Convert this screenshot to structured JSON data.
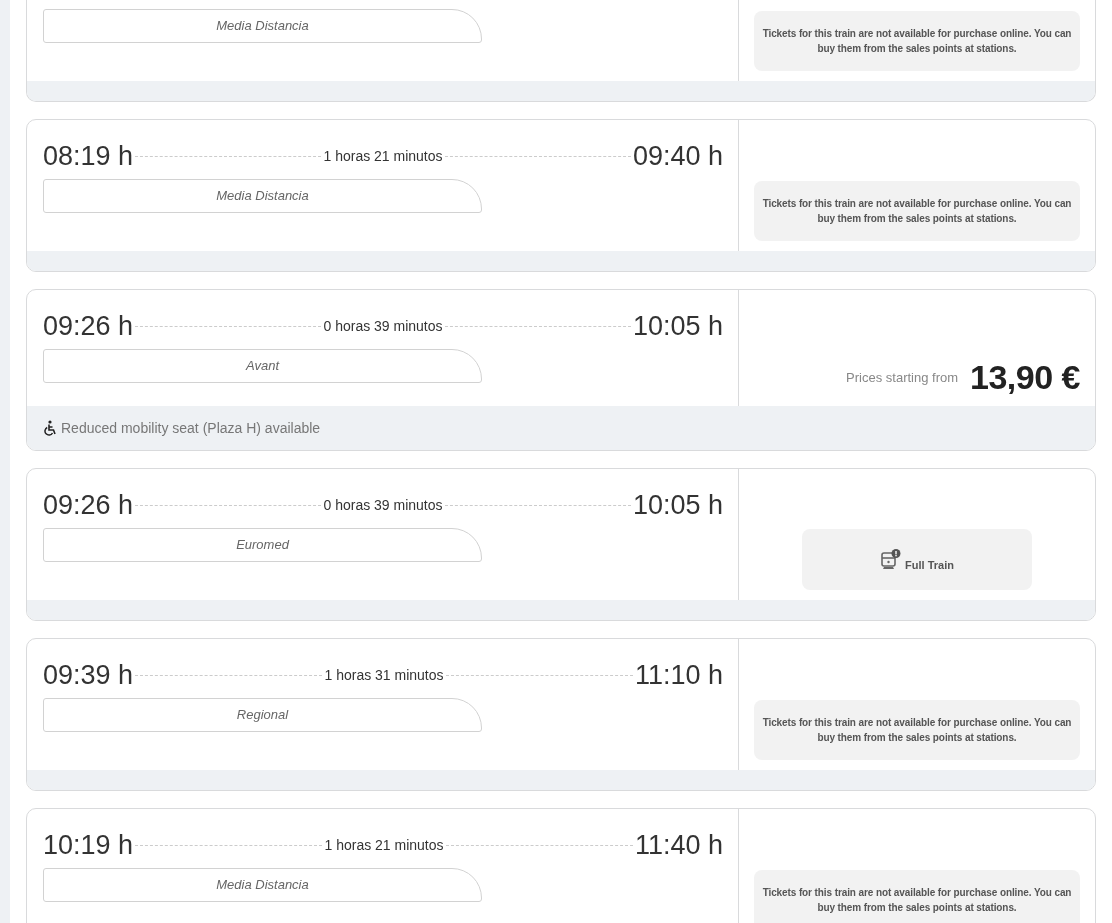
{
  "trains": [
    {
      "train_type": "Media Distancia",
      "offer": {
        "kind": "unavailable",
        "message": "Tickets for this train are not available for purchase online. You can buy them from the sales points at stations."
      }
    },
    {
      "departure": "08:19 h",
      "duration": "1 horas 21 minutos",
      "arrival": "09:40 h",
      "train_type": "Media Distancia",
      "offer": {
        "kind": "unavailable",
        "message": "Tickets for this train are not available for purchase online. You can buy them from the sales points at stations."
      }
    },
    {
      "departure": "09:26 h",
      "duration": "0 horas 39 minutos",
      "arrival": "10:05 h",
      "train_type": "Avant",
      "offer": {
        "kind": "price",
        "label": "Prices starting from",
        "price": "13,90 €"
      },
      "notice": "Reduced mobility seat (Plaza H) available"
    },
    {
      "departure": "09:26 h",
      "duration": "0 horas 39 minutos",
      "arrival": "10:05 h",
      "train_type": "Euromed",
      "offer": {
        "kind": "full",
        "label": "Full Train"
      }
    },
    {
      "departure": "09:39 h",
      "duration": "1 horas 31 minutos",
      "arrival": "11:10 h",
      "train_type": "Regional",
      "offer": {
        "kind": "unavailable",
        "message": "Tickets for this train are not available for purchase online. You can buy them from the sales points at stations."
      }
    },
    {
      "departure": "10:19 h",
      "duration": "1 horas 21 minutos",
      "arrival": "11:40 h",
      "train_type": "Media Distancia",
      "offer": {
        "kind": "unavailable",
        "message": "Tickets for this train are not available for purchase online. You can buy them from the sales points at stations."
      }
    }
  ]
}
